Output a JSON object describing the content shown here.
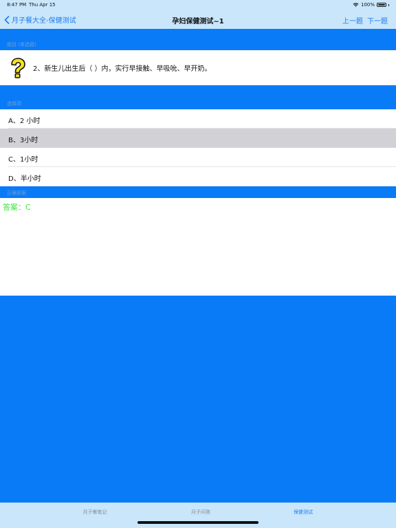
{
  "status": {
    "time": "8:47 PM",
    "date": "Thu Apr 15",
    "battery": "100%"
  },
  "nav": {
    "back_label": "月子餐大全-保健测试",
    "title": "孕妇保健测试~1",
    "prev_label": "上一题",
    "next_label": "下一题"
  },
  "sections": {
    "question_header": "题目 (单选题)",
    "options_header": "选择项",
    "answer_header": "正确答案"
  },
  "question": {
    "text": "2、新生儿出生后（  ）内，实行早接触、早吸吮、早开奶。"
  },
  "options": [
    {
      "label": "A、2 小时",
      "selected": false
    },
    {
      "label": "B、3小时",
      "selected": true
    },
    {
      "label": "C、1小时",
      "selected": false
    },
    {
      "label": "D、半小时",
      "selected": false
    }
  ],
  "answer": {
    "text": "答案：C"
  },
  "tabs": [
    {
      "label": "月子餐笔记",
      "active": false
    },
    {
      "label": "月子问答",
      "active": false
    },
    {
      "label": "保健测试",
      "active": true
    }
  ],
  "colors": {
    "accent": "#1a7cf0",
    "background": "#0a7bf7",
    "bar": "#c9e6fb",
    "answer": "#39e639",
    "selected": "#d1d1d6"
  }
}
